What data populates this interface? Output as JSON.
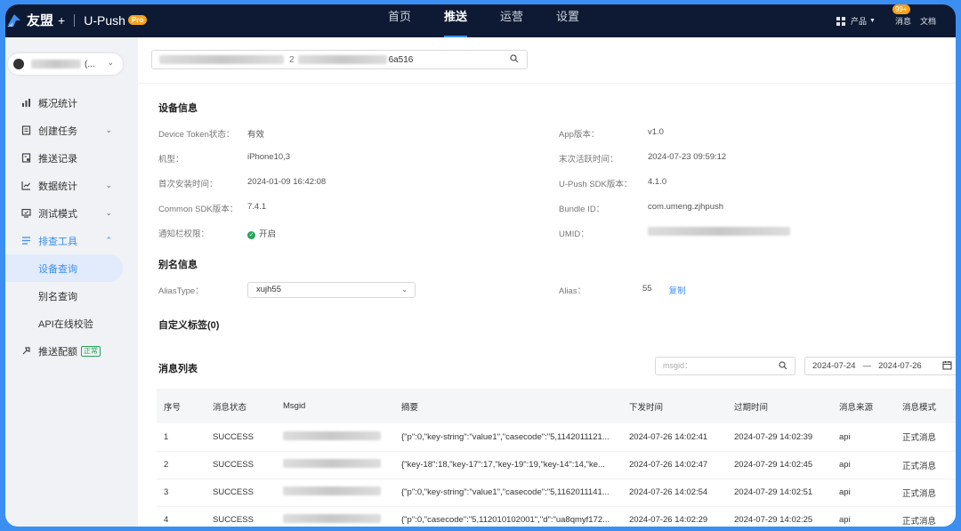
{
  "topbar": {
    "brand": "友盟",
    "plus": "+",
    "product": "U-Push",
    "pro_badge": "Pro",
    "nav": [
      "首页",
      "推送",
      "运营",
      "设置"
    ],
    "active_nav": "推送",
    "products_label": "产品",
    "messages_label": "消息",
    "messages_badge": "99+",
    "docs_label": "文档"
  },
  "sidebar": {
    "app_name_suffix": "(...",
    "menu": [
      {
        "label": "概况统计",
        "icon": "bar-chart-icon"
      },
      {
        "label": "创建任务",
        "icon": "form-icon"
      },
      {
        "label": "推送记录",
        "icon": "record-icon"
      },
      {
        "label": "数据统计",
        "icon": "line-chart-icon"
      },
      {
        "label": "测试模式",
        "icon": "monitor-icon"
      },
      {
        "label": "排查工具",
        "icon": "list-icon"
      }
    ],
    "submenu": [
      "设备查询",
      "别名查询",
      "API在线校验"
    ],
    "quota": {
      "label": "推送配额",
      "tag": "正常"
    }
  },
  "search": {
    "value_suffix": "6a516"
  },
  "device_info": {
    "title": "设备信息",
    "left": [
      {
        "label": "Device Token状态：",
        "value": "有效"
      },
      {
        "label": "机型：",
        "value": "iPhone10,3"
      },
      {
        "label": "首次安装时间：",
        "value": "2024-01-09 16:42:08"
      },
      {
        "label": "Common SDK版本：",
        "value": "7.4.1"
      },
      {
        "label": "通知栏权限：",
        "value": "开启"
      }
    ],
    "right": [
      {
        "label": "App版本：",
        "value": "v1.0"
      },
      {
        "label": "末次活跃时间：",
        "value": "2024-07-23 09:59:12"
      },
      {
        "label": "U-Push SDK版本：",
        "value": "4.1.0"
      },
      {
        "label": "Bundle ID：",
        "value": "com.umeng.zjhpush"
      },
      {
        "label": "UMID：",
        "value": ""
      }
    ]
  },
  "alias_info": {
    "title": "别名信息",
    "alias_type_label": "AliasType：",
    "alias_type_value": "xujh55",
    "alias_label": "Alias：",
    "alias_value": "55",
    "copy_label": "复制"
  },
  "custom_tags": {
    "title": "自定义标签(0)"
  },
  "message_list": {
    "title": "消息列表",
    "msgid_placeholder": "msgid：",
    "date_start": "2024-07-24",
    "date_end": "2024-07-26",
    "columns": [
      "序号",
      "消息状态",
      "Msgid",
      "摘要",
      "下发时间",
      "过期时间",
      "消息来源",
      "消息模式"
    ],
    "rows": [
      {
        "no": "1",
        "status": "SUCCESS",
        "summary": "{\"p\":0,\"key-string\":\"value1\",\"casecode\":\"5,1142011121...",
        "send_time": "2024-07-26 14:02:41",
        "expire_time": "2024-07-29 14:02:39",
        "source": "api",
        "mode": "正式消息"
      },
      {
        "no": "2",
        "status": "SUCCESS",
        "summary": "{\"key-18\":18,\"key-17\":17,\"key-19\":19,\"key-14\":14,\"ke...",
        "send_time": "2024-07-26 14:02:47",
        "expire_time": "2024-07-29 14:02:45",
        "source": "api",
        "mode": "正式消息"
      },
      {
        "no": "3",
        "status": "SUCCESS",
        "summary": "{\"p\":0,\"key-string\":\"value1\",\"casecode\":\"5,1162011141...",
        "send_time": "2024-07-26 14:02:54",
        "expire_time": "2024-07-29 14:02:51",
        "source": "api",
        "mode": "正式消息"
      },
      {
        "no": "4",
        "status": "SUCCESS",
        "summary": "{\"p\":0,\"casecode\":\"5,112010102001\",\"d\":\"ua8qmyf172...",
        "send_time": "2024-07-26 14:02:29",
        "expire_time": "2024-07-29 14:02:25",
        "source": "api",
        "mode": "正式消息"
      }
    ]
  },
  "colors": {
    "accent": "#3b8ff3",
    "topbar": "#0e1a33",
    "sidebar": "#f0f2f5",
    "success": "#27a45a",
    "pro": "#f7a21c"
  }
}
